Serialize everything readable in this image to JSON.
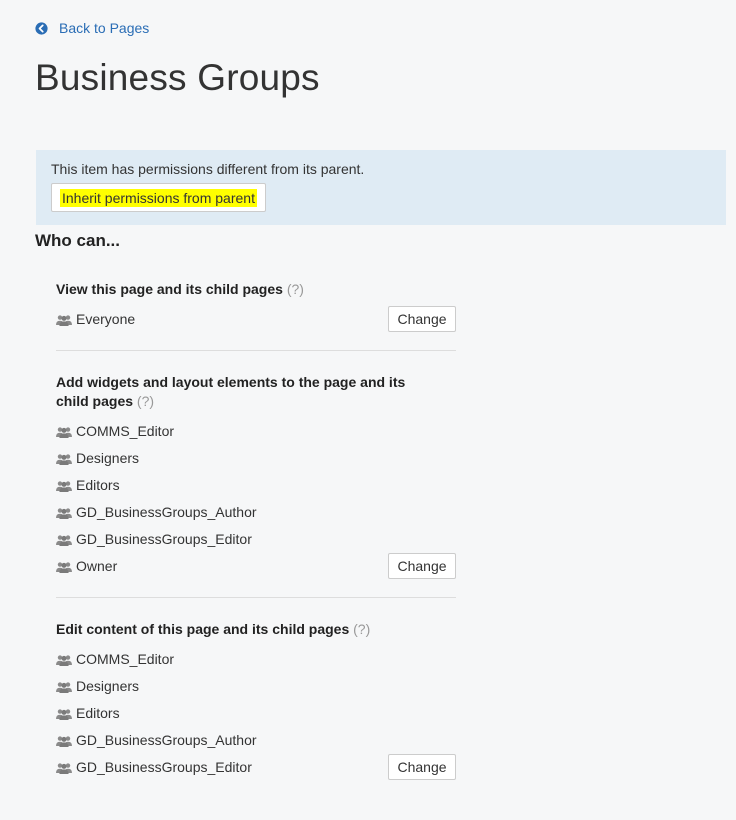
{
  "nav": {
    "back_label": "Back to Pages"
  },
  "page": {
    "title": "Business Groups"
  },
  "notice": {
    "text": "This item has permissions different from its parent.",
    "inherit_label": "Inherit permissions from parent"
  },
  "who_can": "Who can...",
  "help_label": "(?)",
  "change_label": "Change",
  "sections": [
    {
      "title": "View this page and its child pages",
      "groups": [
        "Everyone"
      ]
    },
    {
      "title": "Add widgets and layout elements to the page and its child pages",
      "groups": [
        "COMMS_Editor",
        "Designers",
        "Editors",
        "GD_BusinessGroups_Author",
        "GD_BusinessGroups_Editor",
        "Owner"
      ]
    },
    {
      "title": "Edit content of this page and its child pages",
      "groups": [
        "COMMS_Editor",
        "Designers",
        "Editors",
        "GD_BusinessGroups_Author",
        "GD_BusinessGroups_Editor"
      ]
    }
  ]
}
